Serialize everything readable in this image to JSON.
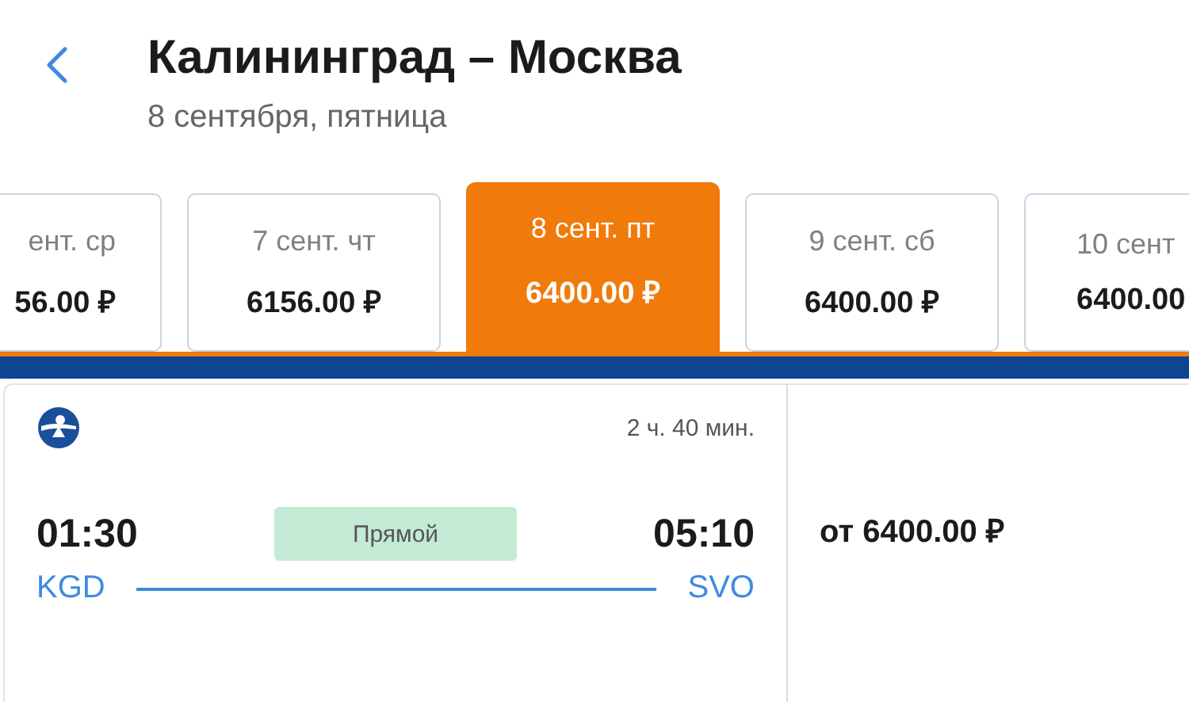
{
  "header": {
    "title": "Калининград – Москва",
    "subtitle": "8 сентября, пятница"
  },
  "dates": [
    {
      "label": "ент. ср",
      "price": "56.00 ₽",
      "selected": false
    },
    {
      "label": "7 сент. чт",
      "price": "6156.00 ₽",
      "selected": false
    },
    {
      "label": "8 сент. пт",
      "price": "6400.00 ₽",
      "selected": true
    },
    {
      "label": "9 сент. сб",
      "price": "6400.00 ₽",
      "selected": false
    },
    {
      "label": "10 сент",
      "price": "6400.00",
      "selected": false
    }
  ],
  "flight": {
    "duration": "2 ч. 40 мин.",
    "depart_time": "01:30",
    "arrive_time": "05:10",
    "type": "Прямой",
    "from": "KGD",
    "to": "SVO",
    "price": "от 6400.00 ₽"
  }
}
